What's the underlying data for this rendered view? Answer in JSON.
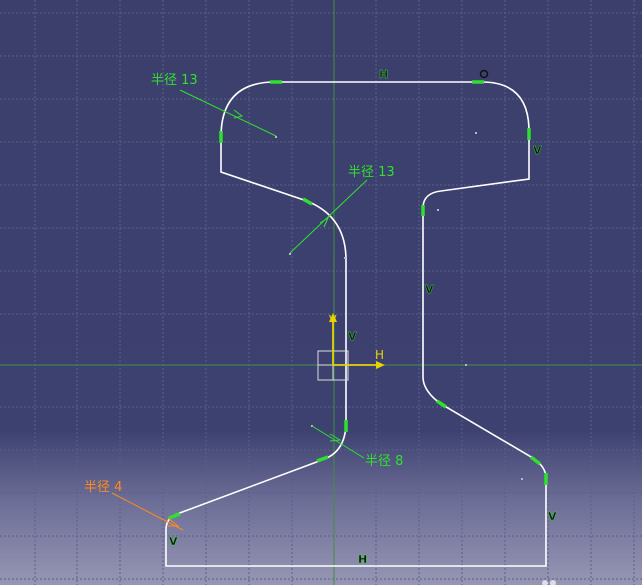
{
  "viewport": {
    "background_colors": [
      "#3c3f6c",
      "#6c6d96",
      "#9696b4"
    ],
    "grid_color": "#5a5e8c",
    "profile_color": "#ffffff",
    "handle_color": "#2fe02f",
    "axis_color": "#e6d400",
    "axis_line_color": "#3f8f3f"
  },
  "dimensions": [
    {
      "label": "半径 13",
      "color": "#2fe02f"
    },
    {
      "label": "半径 13",
      "color": "#2fe02f"
    },
    {
      "label": "半径 8",
      "color": "#2fe02f"
    },
    {
      "label": "半径 4",
      "color": "#ff8a1e"
    }
  ],
  "constraints": {
    "horizontal": "H",
    "vertical": "V",
    "tangent_icon": "tangent-circle-icon"
  },
  "axis": {
    "horizontal_label": "H",
    "vertical_label": "V"
  }
}
